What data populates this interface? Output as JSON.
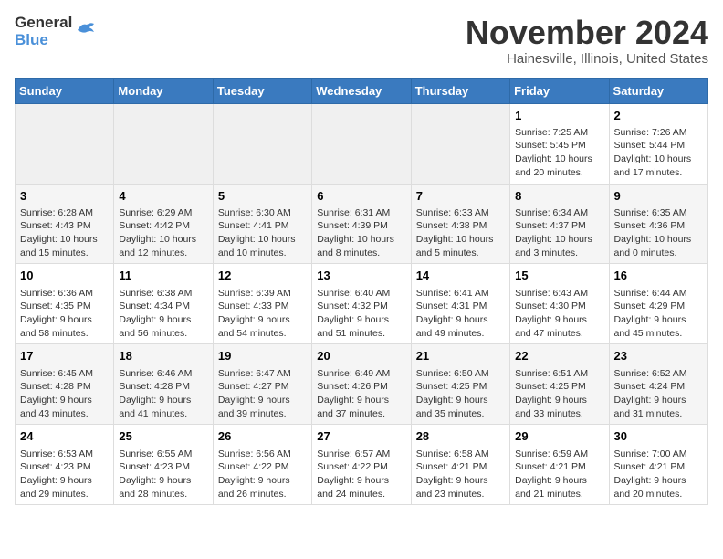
{
  "header": {
    "logo_line1": "General",
    "logo_line2": "Blue",
    "month_title": "November 2024",
    "location": "Hainesville, Illinois, United States"
  },
  "weekdays": [
    "Sunday",
    "Monday",
    "Tuesday",
    "Wednesday",
    "Thursday",
    "Friday",
    "Saturday"
  ],
  "weeks": [
    [
      {
        "day": "",
        "info": ""
      },
      {
        "day": "",
        "info": ""
      },
      {
        "day": "",
        "info": ""
      },
      {
        "day": "",
        "info": ""
      },
      {
        "day": "",
        "info": ""
      },
      {
        "day": "1",
        "info": "Sunrise: 7:25 AM\nSunset: 5:45 PM\nDaylight: 10 hours\nand 20 minutes."
      },
      {
        "day": "2",
        "info": "Sunrise: 7:26 AM\nSunset: 5:44 PM\nDaylight: 10 hours\nand 17 minutes."
      }
    ],
    [
      {
        "day": "3",
        "info": "Sunrise: 6:28 AM\nSunset: 4:43 PM\nDaylight: 10 hours\nand 15 minutes."
      },
      {
        "day": "4",
        "info": "Sunrise: 6:29 AM\nSunset: 4:42 PM\nDaylight: 10 hours\nand 12 minutes."
      },
      {
        "day": "5",
        "info": "Sunrise: 6:30 AM\nSunset: 4:41 PM\nDaylight: 10 hours\nand 10 minutes."
      },
      {
        "day": "6",
        "info": "Sunrise: 6:31 AM\nSunset: 4:39 PM\nDaylight: 10 hours\nand 8 minutes."
      },
      {
        "day": "7",
        "info": "Sunrise: 6:33 AM\nSunset: 4:38 PM\nDaylight: 10 hours\nand 5 minutes."
      },
      {
        "day": "8",
        "info": "Sunrise: 6:34 AM\nSunset: 4:37 PM\nDaylight: 10 hours\nand 3 minutes."
      },
      {
        "day": "9",
        "info": "Sunrise: 6:35 AM\nSunset: 4:36 PM\nDaylight: 10 hours\nand 0 minutes."
      }
    ],
    [
      {
        "day": "10",
        "info": "Sunrise: 6:36 AM\nSunset: 4:35 PM\nDaylight: 9 hours\nand 58 minutes."
      },
      {
        "day": "11",
        "info": "Sunrise: 6:38 AM\nSunset: 4:34 PM\nDaylight: 9 hours\nand 56 minutes."
      },
      {
        "day": "12",
        "info": "Sunrise: 6:39 AM\nSunset: 4:33 PM\nDaylight: 9 hours\nand 54 minutes."
      },
      {
        "day": "13",
        "info": "Sunrise: 6:40 AM\nSunset: 4:32 PM\nDaylight: 9 hours\nand 51 minutes."
      },
      {
        "day": "14",
        "info": "Sunrise: 6:41 AM\nSunset: 4:31 PM\nDaylight: 9 hours\nand 49 minutes."
      },
      {
        "day": "15",
        "info": "Sunrise: 6:43 AM\nSunset: 4:30 PM\nDaylight: 9 hours\nand 47 minutes."
      },
      {
        "day": "16",
        "info": "Sunrise: 6:44 AM\nSunset: 4:29 PM\nDaylight: 9 hours\nand 45 minutes."
      }
    ],
    [
      {
        "day": "17",
        "info": "Sunrise: 6:45 AM\nSunset: 4:28 PM\nDaylight: 9 hours\nand 43 minutes."
      },
      {
        "day": "18",
        "info": "Sunrise: 6:46 AM\nSunset: 4:28 PM\nDaylight: 9 hours\nand 41 minutes."
      },
      {
        "day": "19",
        "info": "Sunrise: 6:47 AM\nSunset: 4:27 PM\nDaylight: 9 hours\nand 39 minutes."
      },
      {
        "day": "20",
        "info": "Sunrise: 6:49 AM\nSunset: 4:26 PM\nDaylight: 9 hours\nand 37 minutes."
      },
      {
        "day": "21",
        "info": "Sunrise: 6:50 AM\nSunset: 4:25 PM\nDaylight: 9 hours\nand 35 minutes."
      },
      {
        "day": "22",
        "info": "Sunrise: 6:51 AM\nSunset: 4:25 PM\nDaylight: 9 hours\nand 33 minutes."
      },
      {
        "day": "23",
        "info": "Sunrise: 6:52 AM\nSunset: 4:24 PM\nDaylight: 9 hours\nand 31 minutes."
      }
    ],
    [
      {
        "day": "24",
        "info": "Sunrise: 6:53 AM\nSunset: 4:23 PM\nDaylight: 9 hours\nand 29 minutes."
      },
      {
        "day": "25",
        "info": "Sunrise: 6:55 AM\nSunset: 4:23 PM\nDaylight: 9 hours\nand 28 minutes."
      },
      {
        "day": "26",
        "info": "Sunrise: 6:56 AM\nSunset: 4:22 PM\nDaylight: 9 hours\nand 26 minutes."
      },
      {
        "day": "27",
        "info": "Sunrise: 6:57 AM\nSunset: 4:22 PM\nDaylight: 9 hours\nand 24 minutes."
      },
      {
        "day": "28",
        "info": "Sunrise: 6:58 AM\nSunset: 4:21 PM\nDaylight: 9 hours\nand 23 minutes."
      },
      {
        "day": "29",
        "info": "Sunrise: 6:59 AM\nSunset: 4:21 PM\nDaylight: 9 hours\nand 21 minutes."
      },
      {
        "day": "30",
        "info": "Sunrise: 7:00 AM\nSunset: 4:21 PM\nDaylight: 9 hours\nand 20 minutes."
      }
    ]
  ]
}
